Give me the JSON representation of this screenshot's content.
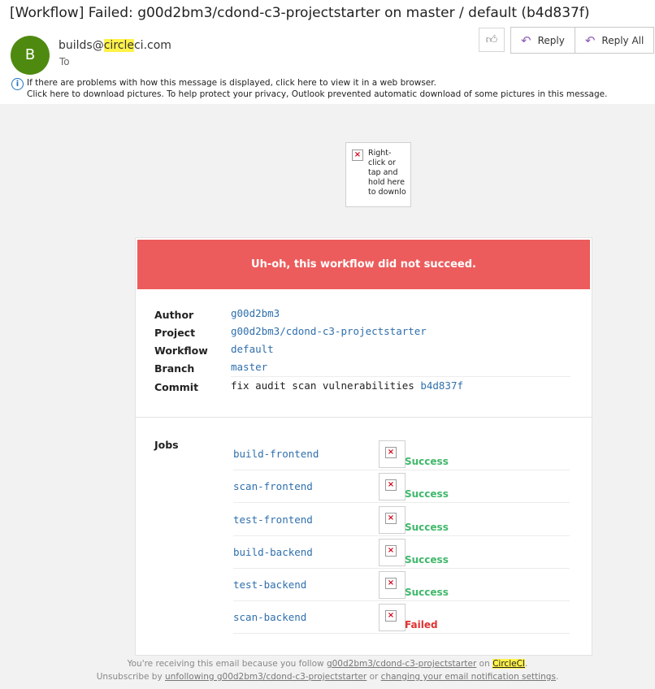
{
  "email": {
    "subject": "[Workflow] Failed: g00d2bm3/cdond-c3-projectstarter on master / default (b4d837f)",
    "avatar_initial": "B",
    "from_pre": "builds@",
    "from_highlight": "circle",
    "from_post": "ci.com",
    "to_label": "To",
    "info_line1": "If there are problems with how this message is displayed, click here to view it in a web browser.",
    "info_line2": "Click here to download pictures. To help protect your privacy, Outlook prevented automatic download of some pictures in this message."
  },
  "actions": {
    "like_icon": "thumbs-up-icon",
    "reply_label": "Reply",
    "reply_all_label": "Reply All",
    "accent_color": "#8f5bb8"
  },
  "logo_placeholder_text": "Right-click or tap and hold here to downlo",
  "banner": {
    "text": "Uh-oh, this workflow did not succeed.",
    "color": "#ec5c5c"
  },
  "details": {
    "author_label": "Author",
    "author": "g00d2bm3",
    "project_label": "Project",
    "project": "g00d2bm3/cdond-c3-projectstarter",
    "workflow_label": "Workflow",
    "workflow": "default",
    "branch_label": "Branch",
    "branch": "master",
    "commit_label": "Commit",
    "commit_message": "fix audit scan vulnerabilities",
    "commit_hash": "b4d837f"
  },
  "jobs": {
    "label": "Jobs",
    "items": [
      {
        "name": "build-frontend",
        "status": "Success"
      },
      {
        "name": "scan-frontend",
        "status": "Success"
      },
      {
        "name": "test-frontend",
        "status": "Success"
      },
      {
        "name": "build-backend",
        "status": "Success"
      },
      {
        "name": "test-backend",
        "status": "Success"
      },
      {
        "name": "scan-backend",
        "status": "Failed"
      }
    ],
    "success_color": "#3fb86a",
    "failed_color": "#e03131"
  },
  "footer": {
    "l1_pre": "You're receiving this email because you follow ",
    "l1_link": "g00d2bm3/cdond-c3-projectstarter",
    "l1_mid": " on ",
    "l1_brand_hl": "Circle",
    "l1_brand_rest": "CI",
    "l1_end": ".",
    "l2_pre": "Unsubscribe by ",
    "l2_link1": "unfollowing g00d2bm3/cdond-c3-projectstarter",
    "l2_mid": " or ",
    "l2_link2": "changing your email notification settings",
    "l2_end": "."
  }
}
